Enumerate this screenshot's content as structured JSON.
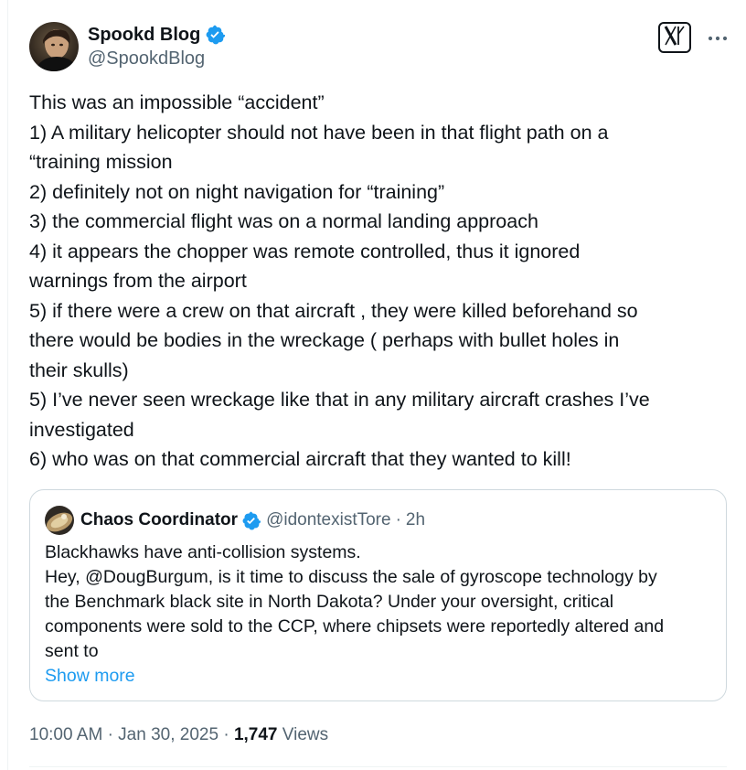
{
  "author": {
    "name": "Spookd Blog",
    "handle": "@SpookdBlog"
  },
  "icons": {
    "verified": "verified-badge-icon",
    "x_logo": "x-logo-icon",
    "more": "more-icon"
  },
  "colors": {
    "verified": "#1d9bf0",
    "link": "#1d9bf0",
    "text": "#0f1419",
    "secondary": "#536471",
    "border": "#cfd9de"
  },
  "post": {
    "lines": [
      "This was an impossible “accident”",
      "1) A military helicopter should not have been in that flight path on a",
      "“training mission",
      "2) definitely not on night navigation for “training”",
      "3) the commercial flight was on a normal landing approach",
      "4) it appears the chopper was remote controlled, thus it ignored",
      "warnings from the airport",
      "5) if there were a crew on that aircraft , they were killed beforehand so",
      "there would be bodies in the wreckage ( perhaps with bullet holes in",
      "their skulls)",
      "5) I’ve never seen wreckage like that in any military aircraft crashes I’ve",
      "investigated",
      "6) who was on that commercial aircraft that they wanted to kill!"
    ]
  },
  "quote": {
    "name": "Chaos Coordinator",
    "handle": "@idontexistTore",
    "separator": "·",
    "time": "2h",
    "lines": [
      "Blackhawks have anti-collision systems.",
      "Hey, @DougBurgum, is it time to discuss the sale of gyroscope technology by",
      "the Benchmark black site in North Dakota? Under your oversight, critical",
      "components were sold to the CCP, where chipsets were reportedly altered and",
      "sent to"
    ],
    "show_more": "Show more"
  },
  "meta": {
    "time": "10:00 AM",
    "separator": "·",
    "date": "Jan 30, 2025",
    "views_count": "1,747",
    "views_label": "Views"
  }
}
